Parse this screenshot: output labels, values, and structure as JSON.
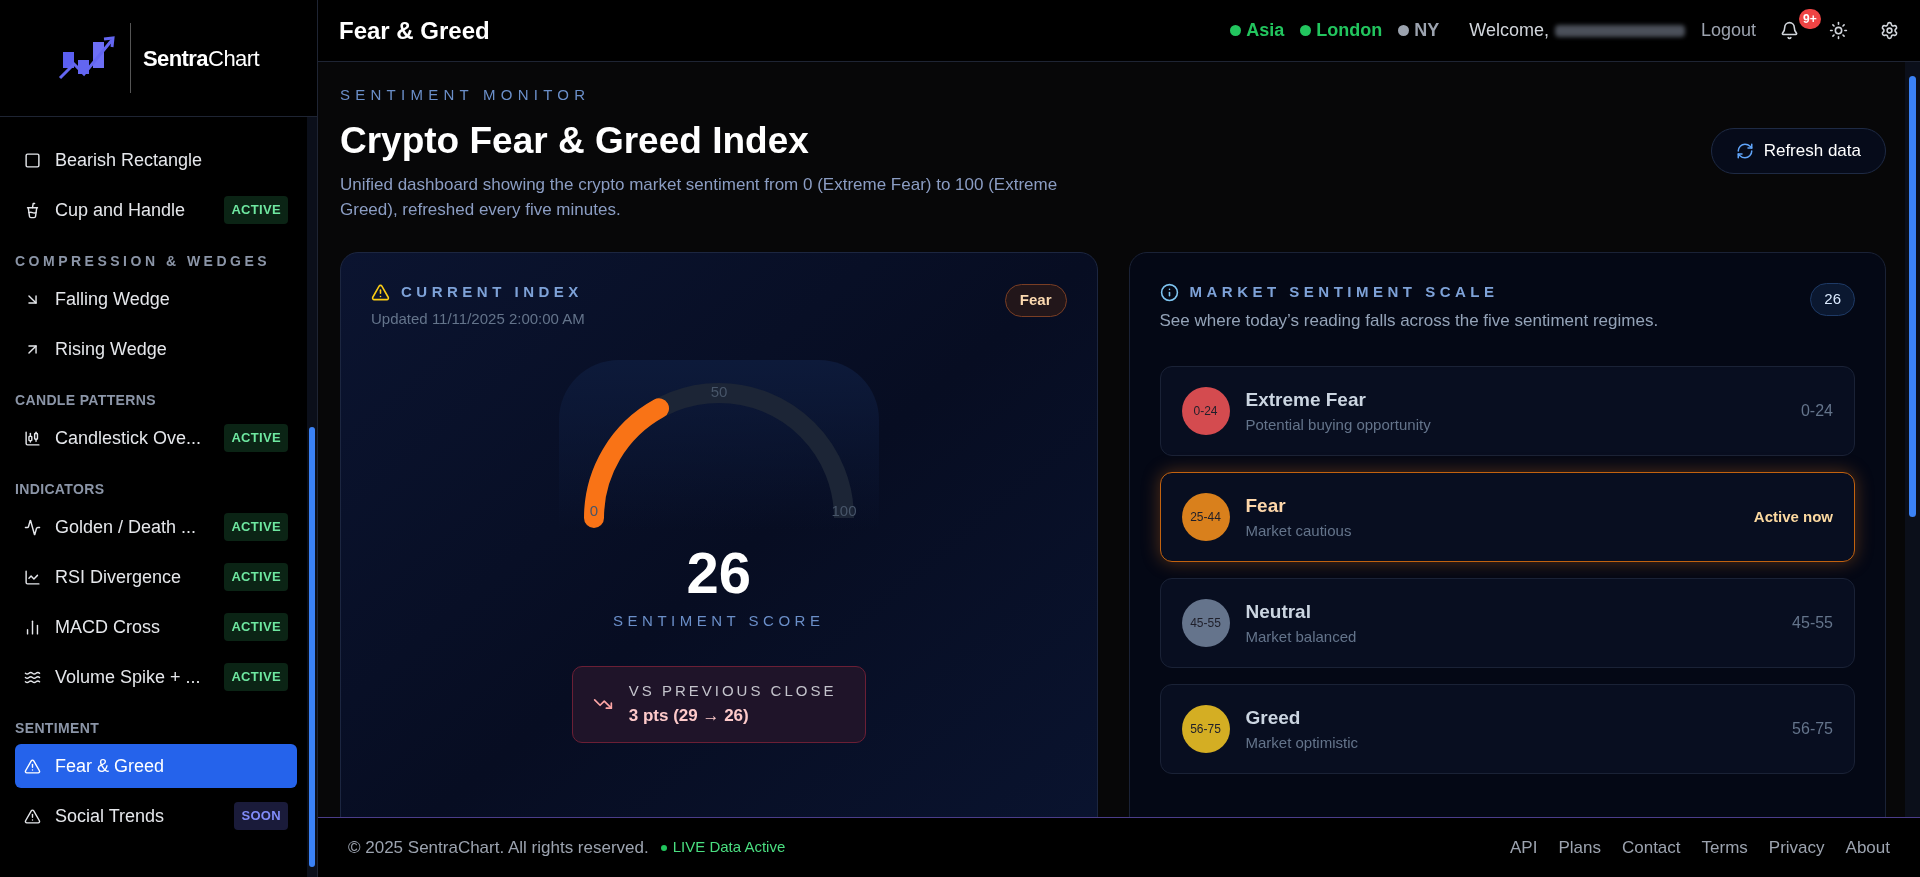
{
  "sidebar": {
    "logo": "**Sentra**Chart",
    "groups": [
      {
        "items": [
          {
            "label": "Bearish Rectangle",
            "selected": false
          },
          {
            "label": "Cup and Handle",
            "badge": {
              "text": "ACTIVE",
              "kind": "active"
            },
            "selected": false
          }
        ]
      },
      {
        "heading": "COMPRESSION & WEDGES",
        "items": [
          {
            "label": "Falling Wedge",
            "selected": false
          },
          {
            "label": "Rising Wedge",
            "selected": false
          }
        ]
      },
      {
        "heading": "CANDLE PATTERNS",
        "items": [
          {
            "label": "Candlestick Ove...",
            "badge": {
              "text": "ACTIVE",
              "kind": "active"
            },
            "selected": false
          }
        ]
      },
      {
        "heading": "INDICATORS",
        "items": [
          {
            "label": "Golden / Death ...",
            "badge": {
              "text": "ACTIVE",
              "kind": "active"
            },
            "selected": false
          },
          {
            "label": "RSI Divergence",
            "badge": {
              "text": "ACTIVE",
              "kind": "active"
            },
            "selected": false
          },
          {
            "label": "MACD Cross",
            "badge": {
              "text": "ACTIVE",
              "kind": "active"
            },
            "selected": false
          },
          {
            "label": "Volume Spike + ...",
            "badge": {
              "text": "ACTIVE",
              "kind": "active"
            },
            "selected": false
          }
        ]
      },
      {
        "heading": "SENTIMENT",
        "items": [
          {
            "label": "Fear & Greed",
            "selected": true
          },
          {
            "label": "Social Trends",
            "badge": {
              "text": "SOON",
              "kind": "soon"
            },
            "selected": false
          }
        ]
      }
    ]
  },
  "header": {
    "title": "Fear & Greed",
    "markets": [
      {
        "name": "Asia",
        "color": "#22c55e"
      },
      {
        "name": "London",
        "color": "#22c55e"
      },
      {
        "name": "NY",
        "color": "#9ca3af"
      }
    ],
    "welcome": "Welcome,",
    "logout": "Logout",
    "notifications": "9+"
  },
  "page": {
    "eyebrow": "SENTIMENT MONITOR",
    "title": "Crypto Fear & Greed Index",
    "description": "Unified dashboard showing the crypto market sentiment from 0 (Extreme Fear) to 100 (Extreme Greed), refreshed every five minutes.",
    "refresh_button": "Refresh data"
  },
  "current_index": {
    "label": "CURRENT INDEX",
    "updated": "Updated 11/11/2025 2:00:00 AM",
    "badge": "Fear",
    "level": 0.26,
    "ticks": [
      "0",
      "50",
      "100"
    ],
    "score": "26",
    "score_label": "SENTIMENT SCORE",
    "delta": {
      "label": "VS PREVIOUS CLOSE",
      "value": "3 pts (29 → 26)"
    }
  },
  "scale": {
    "label": "MARKET SENTIMENT SCALE",
    "description": "See where today’s reading falls across the five sentiment regimes.",
    "badge": "26",
    "rows": [
      {
        "circle": "0-24",
        "title": "Extreme Fear",
        "subtitle": "Potential buying opportunity",
        "aside": "0-24",
        "color": "#d44b4f",
        "selected": false
      },
      {
        "circle": "25-44",
        "title": "Fear",
        "subtitle": "Market cautious",
        "aside": "Active now",
        "color": "#d9801c",
        "selected": true
      },
      {
        "circle": "45-55",
        "title": "Neutral",
        "subtitle": "Market balanced",
        "aside": "45-55",
        "color": "#65748c",
        "selected": false
      },
      {
        "circle": "56-75",
        "title": "Greed",
        "subtitle": "Market optimistic",
        "aside": "56-75",
        "color": "#d4ae23",
        "selected": false
      }
    ]
  },
  "footer": {
    "copyright": "© 2025 SentraChart. All rights reserved.",
    "live": "LIVE Data Active",
    "links": [
      "API",
      "Plans",
      "Contact",
      "Terms",
      "Privacy",
      "About"
    ]
  }
}
